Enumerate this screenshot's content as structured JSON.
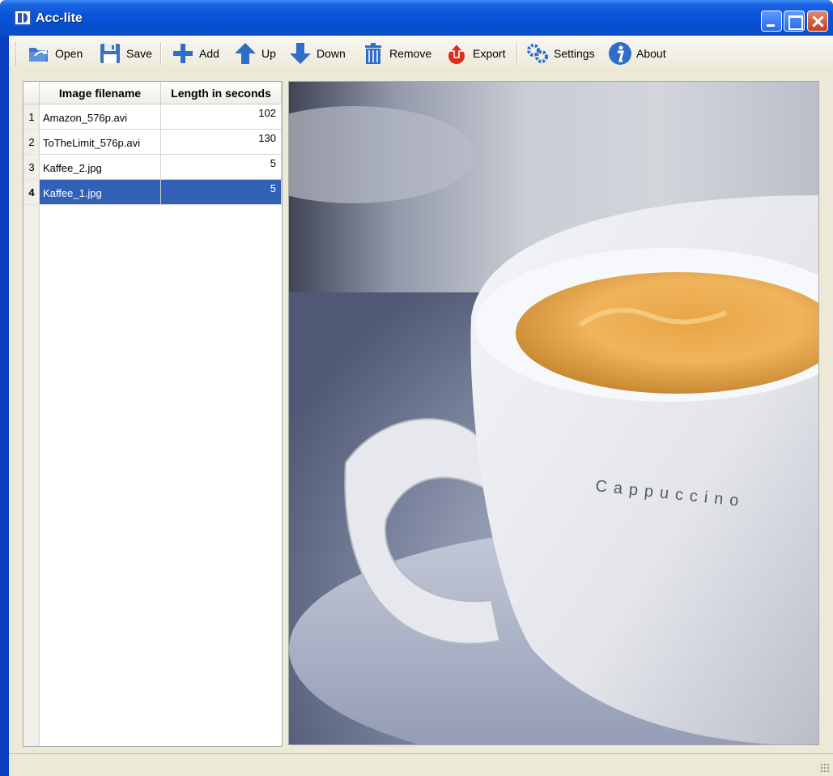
{
  "window": {
    "title": "Acc-lite"
  },
  "toolbar": {
    "open": "Open",
    "save": "Save",
    "add": "Add",
    "up": "Up",
    "down": "Down",
    "remove": "Remove",
    "export": "Export",
    "settings": "Settings",
    "about": "About"
  },
  "table": {
    "columns": [
      "Image filename",
      "Length in seconds"
    ],
    "rows": [
      {
        "num": "1",
        "filename": "Amazon_576p.avi",
        "length": "102"
      },
      {
        "num": "2",
        "filename": "ToTheLimit_576p.avi",
        "length": "130"
      },
      {
        "num": "3",
        "filename": "Kaffee_2.jpg",
        "length": "5"
      },
      {
        "num": "4",
        "filename": "Kaffee_1.jpg",
        "length": "5"
      }
    ],
    "selected_row": 4
  },
  "preview": {
    "cup_text": "Cappuccino"
  },
  "colors": {
    "titlebar": "#0a54d8",
    "selection": "#3162b8",
    "face": "#ece9d8"
  }
}
